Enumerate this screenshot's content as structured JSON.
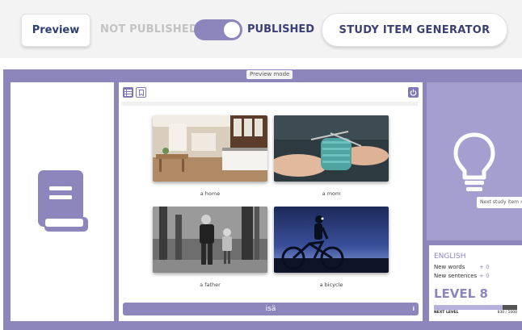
{
  "toolbar": {
    "preview_label": "Preview",
    "not_published_label": "NOT PUBLISHED",
    "published_label": "PUBLISHED",
    "publish_toggle_state": "on",
    "generator_label": "STUDY ITEM GENERATOR"
  },
  "app": {
    "mode_badge": "Preview mode",
    "left_panel_icon": "book-icon",
    "toolbar_icons": [
      "list-icon",
      "bookmark-icon",
      "power-icon"
    ],
    "cards": [
      {
        "caption": "a home",
        "image": "kitchen-photo"
      },
      {
        "caption": "a mom",
        "image": "knitting-photo"
      },
      {
        "caption": "a father",
        "image": "father-child-photo"
      },
      {
        "caption": "a bicycle",
        "image": "cyclist-night-photo"
      }
    ],
    "answer": {
      "text": "isä",
      "info_icon": "i"
    },
    "right_panel": {
      "icon": "lightbulb-icon",
      "next_item_label": "Next study item »"
    },
    "stats": {
      "language": "ENGLISH",
      "new_words_label": "New words",
      "new_words_value": "+ 0",
      "new_sentences_label": "New sentences",
      "new_sentences_value": "+ 0",
      "level": "LEVEL 8",
      "next_level_label": "NEXT LEVEL",
      "progress_text": "830 / 1000",
      "progress_fraction": 0.83
    }
  },
  "colors": {
    "accent": "#8d86bc",
    "navy": "#3a3f78",
    "light_purple": "#a59fd0"
  }
}
